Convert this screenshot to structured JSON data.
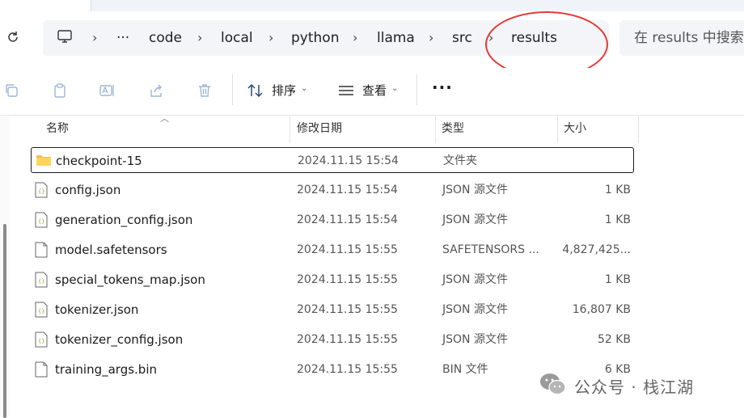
{
  "address": {
    "overflow_label": "···",
    "crumbs": [
      "code",
      "local",
      "python",
      "llama",
      "src",
      "results"
    ]
  },
  "search": {
    "placeholder": "在 results 中搜索"
  },
  "toolbar": {
    "sort_label": "排序",
    "view_label": "查看",
    "more_label": "···"
  },
  "columns": {
    "name": "名称",
    "modified": "修改日期",
    "type": "类型",
    "size": "大小"
  },
  "files": [
    {
      "name": "checkpoint-15",
      "modified": "2024.11.15 15:54",
      "type": "文件夹",
      "size": "",
      "icon": "folder-icon",
      "selected": true
    },
    {
      "name": "config.json",
      "modified": "2024.11.15 15:54",
      "type": "JSON 源文件",
      "size": "1 KB",
      "icon": "json-file-icon"
    },
    {
      "name": "generation_config.json",
      "modified": "2024.11.15 15:54",
      "type": "JSON 源文件",
      "size": "1 KB",
      "icon": "json-file-icon"
    },
    {
      "name": "model.safetensors",
      "modified": "2024.11.15 15:55",
      "type": "SAFETENSORS ...",
      "size": "4,827,425...",
      "icon": "file-icon"
    },
    {
      "name": "special_tokens_map.json",
      "modified": "2024.11.15 15:55",
      "type": "JSON 源文件",
      "size": "1 KB",
      "icon": "json-file-icon"
    },
    {
      "name": "tokenizer.json",
      "modified": "2024.11.15 15:55",
      "type": "JSON 源文件",
      "size": "16,807 KB",
      "icon": "json-file-icon"
    },
    {
      "name": "tokenizer_config.json",
      "modified": "2024.11.15 15:55",
      "type": "JSON 源文件",
      "size": "52 KB",
      "icon": "json-file-icon"
    },
    {
      "name": "training_args.bin",
      "modified": "2024.11.15 15:55",
      "type": "BIN 文件",
      "size": "6 KB",
      "icon": "file-icon"
    }
  ],
  "watermark": {
    "text": "公众号 · 栈江湖"
  },
  "colors": {
    "annotation": "#e53935",
    "folder": "#f5c03b",
    "json_icon": "#9aa53a"
  }
}
